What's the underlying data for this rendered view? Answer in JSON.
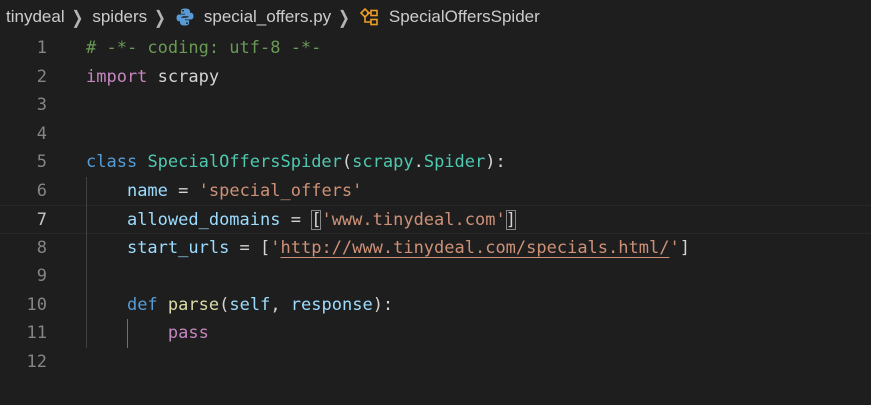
{
  "breadcrumb": {
    "folder1": "tinydeal",
    "folder2": "spiders",
    "file": "special_offers.py",
    "symbol": "SpecialOffersSpider"
  },
  "colors": {
    "background": "#1e1e1e",
    "keyword": "#c586c0",
    "declaration": "#569cd6",
    "class": "#4ec9b0",
    "string": "#ce9178",
    "comment": "#6a9955",
    "function": "#dcdcaa",
    "variable": "#9cdcfe"
  },
  "icons": {
    "file": "python-file-icon",
    "symbol": "class-symbol-icon",
    "separator": "chevron-right-icon"
  },
  "lines": [
    {
      "n": "1",
      "indent": "",
      "tokens": [
        {
          "t": "# -*- coding: utf-8 -*-",
          "c": "c-comment"
        }
      ]
    },
    {
      "n": "2",
      "indent": "",
      "tokens": [
        {
          "t": "import",
          "c": "c-kw"
        },
        {
          "t": " scrapy",
          "c": "c-punc"
        }
      ]
    },
    {
      "n": "3",
      "indent": "",
      "tokens": []
    },
    {
      "n": "4",
      "indent": "",
      "tokens": []
    },
    {
      "n": "5",
      "indent": "",
      "tokens": [
        {
          "t": "class",
          "c": "c-decl"
        },
        {
          "t": " ",
          "c": "c-punc"
        },
        {
          "t": "SpecialOffersSpider",
          "c": "c-cls"
        },
        {
          "t": "(",
          "c": "c-punc"
        },
        {
          "t": "scrapy",
          "c": "c-cls"
        },
        {
          "t": ".",
          "c": "c-punc"
        },
        {
          "t": "Spider",
          "c": "c-cls"
        },
        {
          "t": "):",
          "c": "c-punc"
        }
      ]
    },
    {
      "n": "6",
      "indent": "    ",
      "tokens": [
        {
          "t": "name",
          "c": "c-var"
        },
        {
          "t": " = ",
          "c": "c-punc"
        },
        {
          "t": "'special_offers'",
          "c": "c-str"
        }
      ]
    },
    {
      "n": "7",
      "indent": "    ",
      "active": true,
      "tokens": [
        {
          "t": "allowed_domains",
          "c": "c-var"
        },
        {
          "t": " = ",
          "c": "c-punc"
        },
        {
          "t": "[",
          "c": "c-punc bracket-match"
        },
        {
          "t": "'www.tinydeal.com'",
          "c": "c-str"
        },
        {
          "t": "]",
          "c": "c-punc bracket-match"
        }
      ]
    },
    {
      "n": "8",
      "indent": "    ",
      "tokens": [
        {
          "t": "start_urls",
          "c": "c-var"
        },
        {
          "t": " = [",
          "c": "c-punc"
        },
        {
          "t": "'",
          "c": "c-str"
        },
        {
          "t": "http://www.tinydeal.com/specials.html/",
          "c": "c-url"
        },
        {
          "t": "'",
          "c": "c-str"
        },
        {
          "t": "]",
          "c": "c-punc"
        }
      ]
    },
    {
      "n": "9",
      "indent": "",
      "tokens": []
    },
    {
      "n": "10",
      "indent": "    ",
      "tokens": [
        {
          "t": "def",
          "c": "c-decl"
        },
        {
          "t": " ",
          "c": "c-punc"
        },
        {
          "t": "parse",
          "c": "c-fn"
        },
        {
          "t": "(",
          "c": "c-punc"
        },
        {
          "t": "self",
          "c": "c-var"
        },
        {
          "t": ", ",
          "c": "c-punc"
        },
        {
          "t": "response",
          "c": "c-var"
        },
        {
          "t": "):",
          "c": "c-punc"
        }
      ]
    },
    {
      "n": "11",
      "indent": "        ",
      "tokens": [
        {
          "t": "pass",
          "c": "c-kw"
        }
      ]
    },
    {
      "n": "12",
      "indent": "",
      "tokens": []
    }
  ]
}
